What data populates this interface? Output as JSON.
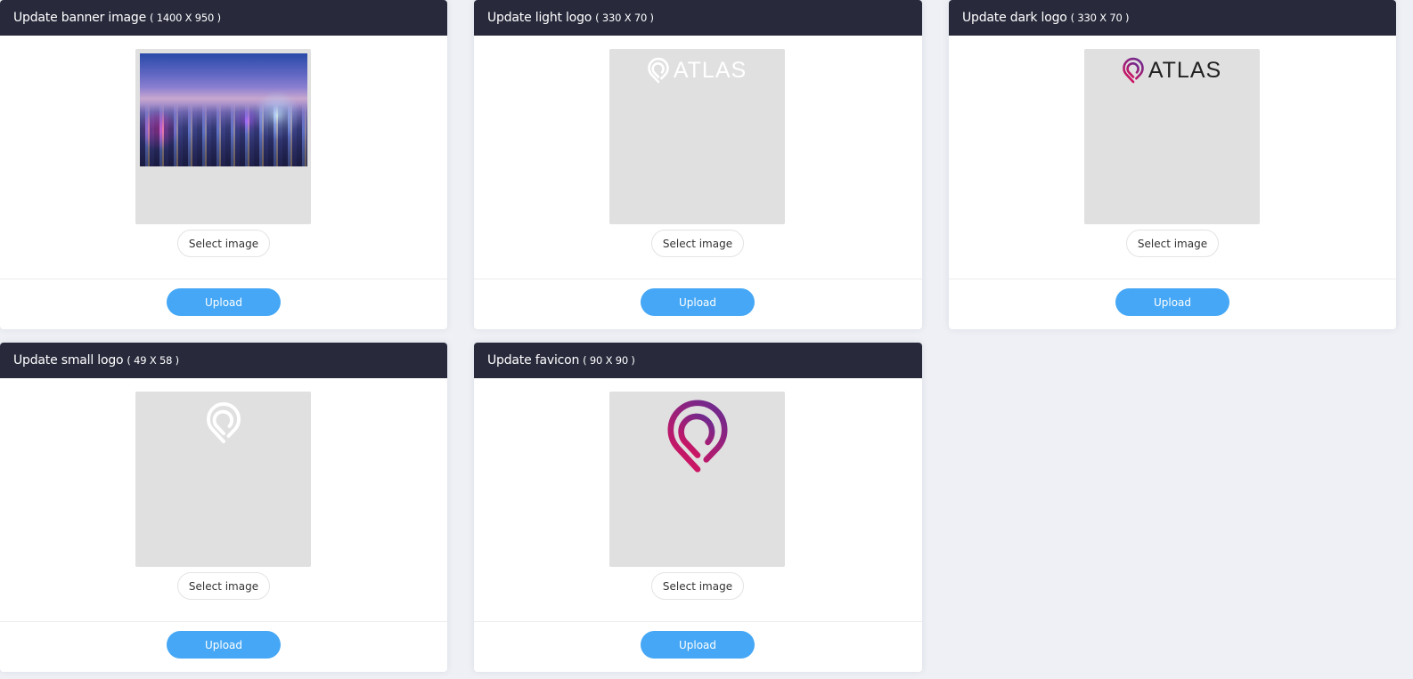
{
  "cards": [
    {
      "title": "Update banner image",
      "dims": "( 1400 X 950 )",
      "preview": "banner-photo",
      "select_label": "Select image",
      "upload_label": "Upload"
    },
    {
      "title": "Update light logo",
      "dims": "( 330 X 70 )",
      "preview": "light-logo",
      "logo_text": "ATLAS",
      "select_label": "Select image",
      "upload_label": "Upload"
    },
    {
      "title": "Update dark logo",
      "dims": "( 330 X 70 )",
      "preview": "dark-logo",
      "logo_text": "ATLAS",
      "select_label": "Select image",
      "upload_label": "Upload"
    },
    {
      "title": "Update small logo",
      "dims": "( 49 X 58 )",
      "preview": "small-logo",
      "select_label": "Select image",
      "upload_label": "Upload"
    },
    {
      "title": "Update favicon",
      "dims": "( 90 X 90 )",
      "preview": "favicon",
      "select_label": "Select image",
      "upload_label": "Upload"
    }
  ],
  "colors": {
    "header_bg": "#282a3c",
    "upload_button": "#45a7f5",
    "brand_gradient_start": "#7b2a8c",
    "brand_gradient_end": "#d0135e",
    "preview_bg": "#e0e0e0"
  }
}
